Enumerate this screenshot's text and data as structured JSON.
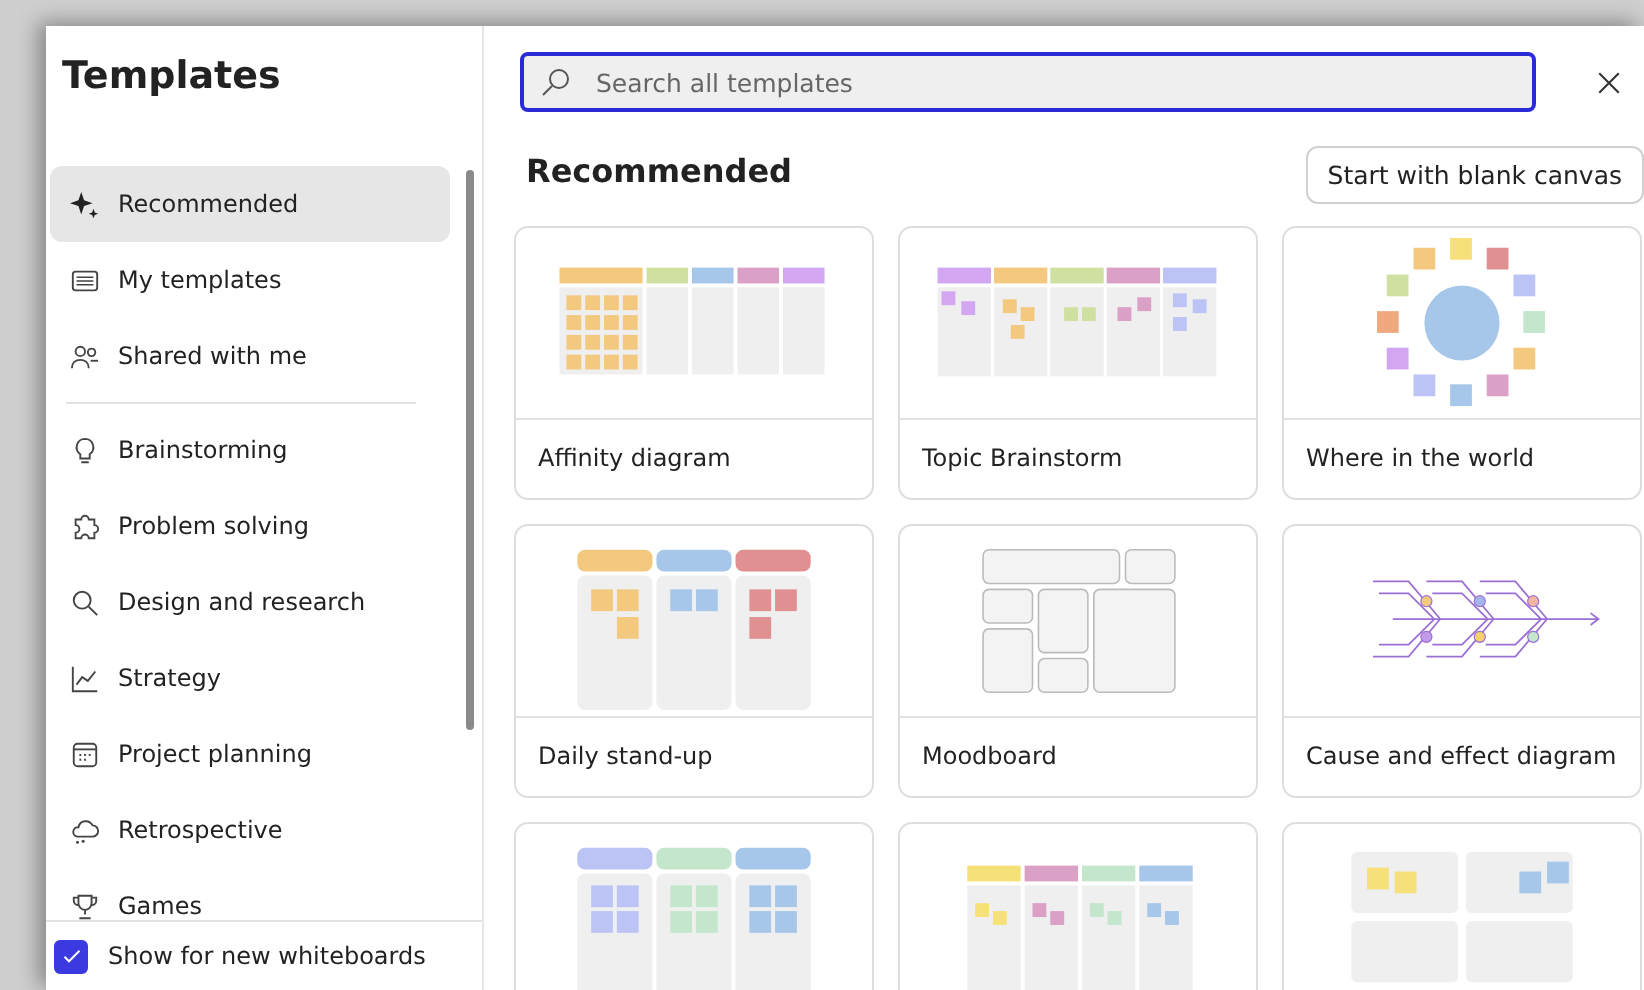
{
  "sidebar": {
    "title": "Templates",
    "sections": [
      {
        "items": [
          {
            "label": "Recommended",
            "selected": true
          },
          {
            "label": "My templates",
            "selected": false
          },
          {
            "label": "Shared with me",
            "selected": false
          }
        ]
      },
      {
        "items": [
          {
            "label": "Brainstorming",
            "selected": false
          },
          {
            "label": "Problem solving",
            "selected": false
          },
          {
            "label": "Design and research",
            "selected": false
          },
          {
            "label": "Strategy",
            "selected": false
          },
          {
            "label": "Project planning",
            "selected": false
          },
          {
            "label": "Retrospective",
            "selected": false
          },
          {
            "label": "Games",
            "selected": false
          }
        ]
      }
    ],
    "footer_checkbox": {
      "label": "Show for new whiteboards",
      "checked": true
    }
  },
  "search": {
    "placeholder": "Search all templates"
  },
  "section": {
    "title": "Recommended",
    "button": "Start with blank canvas"
  },
  "cards": [
    {
      "kind": "affinity",
      "label": "Affinity diagram"
    },
    {
      "kind": "topic",
      "label": "Topic Brainstorm"
    },
    {
      "kind": "world",
      "label": "Where in the world"
    },
    {
      "kind": "standup",
      "label": "Daily stand-up"
    },
    {
      "kind": "moodboard",
      "label": "Moodboard"
    },
    {
      "kind": "fishbone",
      "label": "Cause and effect diagram"
    },
    {
      "kind": "columns3"
    },
    {
      "kind": "columns4"
    },
    {
      "kind": "quadrants"
    }
  ]
}
